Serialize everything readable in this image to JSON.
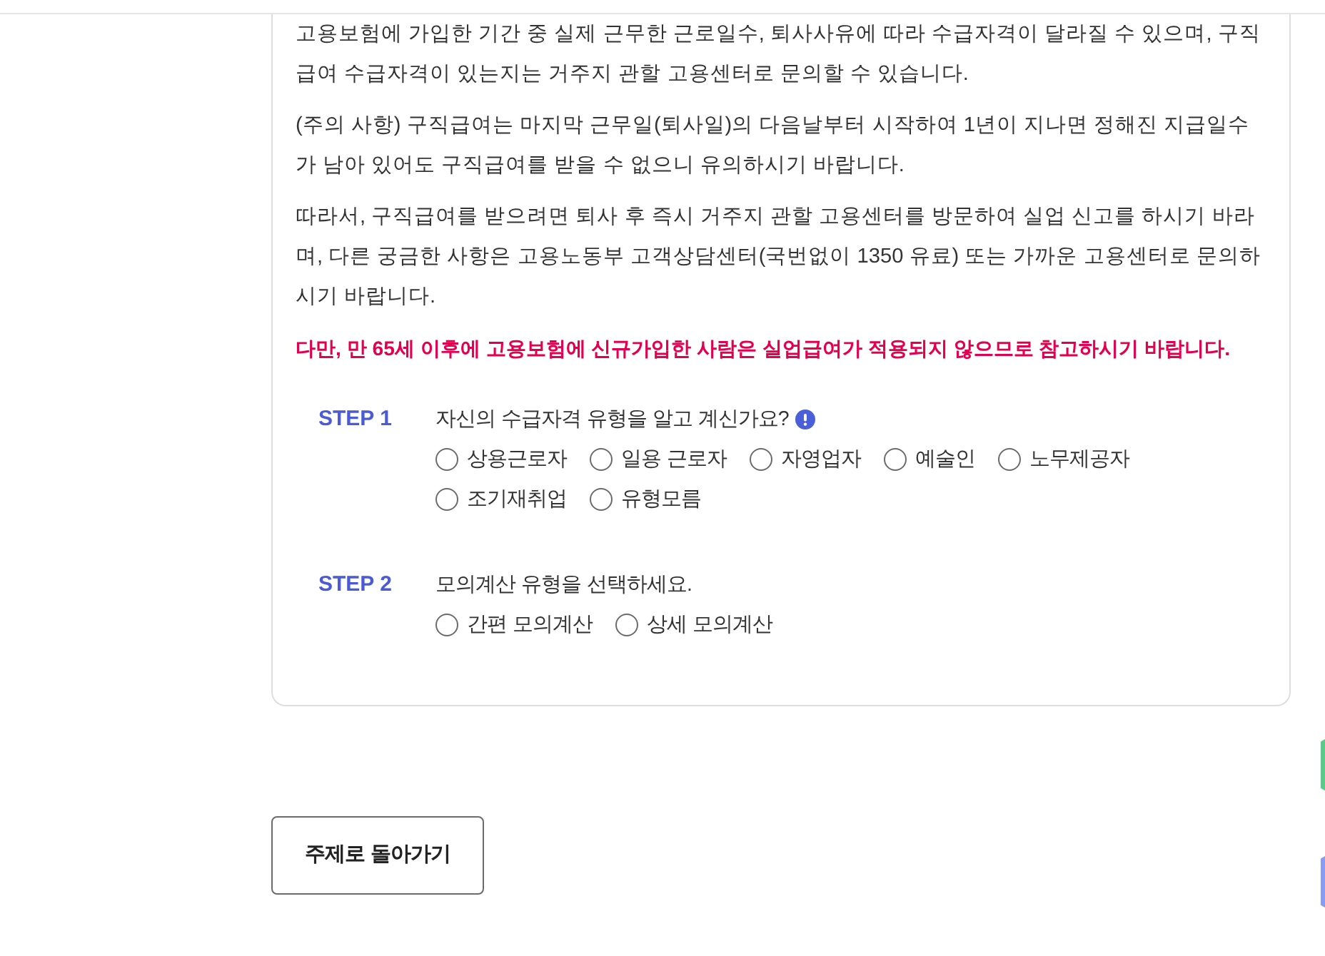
{
  "notice": {
    "paragraphs": [
      {
        "kind": "normal",
        "text": "고용보험에 가입한 기간 중 실제 근무한 근로일수, 퇴사사유에 따라 수급자격이 달라질 수 있으며, 구직급여 수급자격이 있는지는 거주지 관할 고용센터로 문의할 수 있습니다."
      },
      {
        "kind": "normal",
        "text": "(주의 사항) 구직급여는 마지막 근무일(퇴사일)의 다음날부터 시작하여 1년이 지나면 정해진 지급일수가 남아 있어도 구직급여를 받을 수 없으니 유의하시기 바랍니다."
      },
      {
        "kind": "normal",
        "text": "따라서, 구직급여를 받으려면 퇴사 후 즉시 거주지 관할 고용센터를 방문하여 실업 신고를 하시기 바라며, 다른 궁금한 사항은 고용노동부 고객상담센터(국번없이 1350 유료) 또는 가까운 고용센터로 문의하시기 바랍니다."
      },
      {
        "kind": "warning",
        "text": "다만, 만 65세 이후에 고용보험에 신규가입한 사람은 실업급여가 적용되지 않으므로 참고하시기 바랍니다."
      }
    ]
  },
  "steps": [
    {
      "label": "STEP 1",
      "question": "자신의 수급자격 유형을 알고 계신가요?",
      "info": true,
      "options": [
        {
          "label": "상용근로자",
          "selected": false
        },
        {
          "label": "일용 근로자",
          "selected": false
        },
        {
          "label": "자영업자",
          "selected": false
        },
        {
          "label": "예술인",
          "selected": false
        },
        {
          "label": "노무제공자",
          "selected": false
        },
        {
          "label": "조기재취업",
          "selected": false
        },
        {
          "label": "유형모름",
          "selected": false
        }
      ]
    },
    {
      "label": "STEP 2",
      "question": "모의계산 유형을 선택하세요.",
      "info": false,
      "options": [
        {
          "label": "간편 모의계산",
          "selected": false
        },
        {
          "label": "상세 모의계산",
          "selected": false
        }
      ]
    }
  ],
  "back_button": {
    "label": "주제로 돌아가기"
  }
}
